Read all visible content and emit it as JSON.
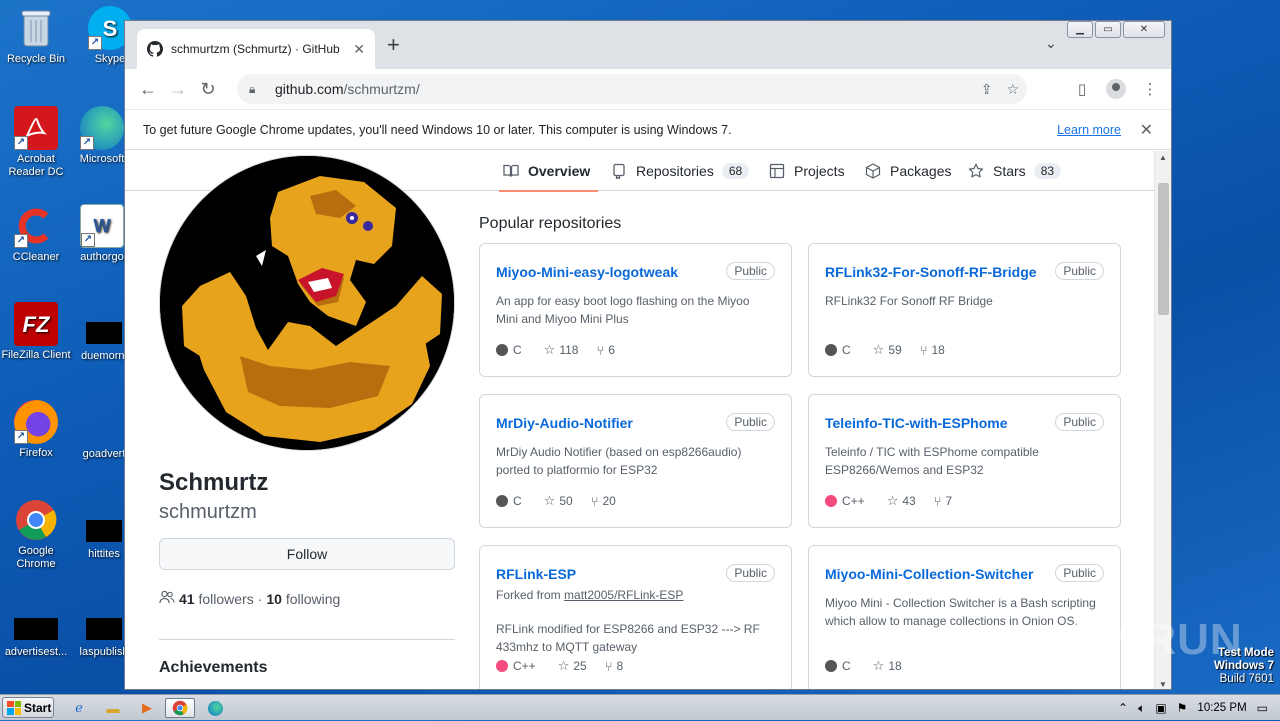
{
  "desktop": {
    "icons": [
      {
        "label": "Recycle Bin"
      },
      {
        "label": "Skype"
      },
      {
        "label": "Acrobat Reader DC"
      },
      {
        "label": "Microsoft"
      },
      {
        "label": "CCleaner"
      },
      {
        "label": "authorgo"
      },
      {
        "label": "FileZilla Client"
      },
      {
        "label": "duemorni"
      },
      {
        "label": "Firefox"
      },
      {
        "label": "goadvert"
      },
      {
        "label": "Google Chrome"
      },
      {
        "label": "hittites"
      },
      {
        "label": "advertisest..."
      },
      {
        "label": "laspublish"
      }
    ]
  },
  "browser": {
    "tab_title": "schmurtzm (Schmurtz) · GitHub",
    "tab_close": "✕",
    "new_tab": "+",
    "url_host": "github.com",
    "url_path": "/schmurtzm/",
    "infobar_text": "To get future Google Chrome updates, you'll need Windows 10 or later. This computer is using Windows 7.",
    "infobar_link": "Learn more",
    "window_buttons": {
      "minimize": "▁",
      "maximize": "▭",
      "close": "✕"
    }
  },
  "profile": {
    "tabs": [
      {
        "label": "Overview",
        "icon": "book-icon",
        "count": ""
      },
      {
        "label": "Repositories",
        "icon": "repo-icon",
        "count": "68"
      },
      {
        "label": "Projects",
        "icon": "table-icon",
        "count": ""
      },
      {
        "label": "Packages",
        "icon": "package-icon",
        "count": ""
      },
      {
        "label": "Stars",
        "icon": "star-icon",
        "count": "83"
      }
    ],
    "name": "Schmurtz",
    "login": "schmurtzm",
    "follow_label": "Follow",
    "followers_count": "41",
    "followers_label": "followers",
    "separator": "·",
    "following_count": "10",
    "following_label": "following",
    "achievements_heading": "Achievements",
    "popular_heading": "Popular repositories"
  },
  "repos": [
    {
      "name": "Miyoo-Mini-easy-logotweak",
      "badge": "Public",
      "desc": "An app for easy boot logo flashing on the Miyoo Mini and Miyoo Mini Plus",
      "lang": "C",
      "lang_color": "#555555",
      "stars": "118",
      "forks": "6"
    },
    {
      "name": "RFLink32-For-Sonoff-RF-Bridge",
      "badge": "Public",
      "desc": "RFLink32 For Sonoff RF Bridge",
      "lang": "C",
      "lang_color": "#555555",
      "stars": "59",
      "forks": "18"
    },
    {
      "name": "MrDiy-Audio-Notifier",
      "badge": "Public",
      "desc": "MrDiy Audio Notifier (based on esp8266audio) ported to platformio for ESP32",
      "lang": "C",
      "lang_color": "#555555",
      "stars": "50",
      "forks": "20"
    },
    {
      "name": "Teleinfo-TIC-with-ESPhome",
      "badge": "Public",
      "desc": "Teleinfo / TIC with ESPhome compatible ESP8266/Wemos and ESP32",
      "lang": "C++",
      "lang_color": "#f34b7d",
      "stars": "43",
      "forks": "7"
    },
    {
      "name": "RFLink-ESP",
      "badge": "Public",
      "forked_prefix": "Forked from",
      "forked_from": "matt2005/RFLink-ESP",
      "desc": "RFLink modified for ESP8266 and ESP32 ---> RF 433mhz to MQTT gateway",
      "lang": "C++",
      "lang_color": "#f34b7d",
      "stars": "25",
      "forks": "8"
    },
    {
      "name": "Miyoo-Mini-Collection-Switcher",
      "badge": "Public",
      "desc": "Miyoo Mini - Collection Switcher is a Bash scripting which allow to manage collections in Onion OS.",
      "lang": "C",
      "lang_color": "#555555",
      "stars": "18",
      "forks": ""
    }
  ],
  "overlay": {
    "watermark": "ANY RUN",
    "testmode_line1": "Test Mode",
    "testmode_line2": "Windows 7",
    "testmode_line3": "Build 7601"
  },
  "taskbar": {
    "start_label": "Start",
    "clock": "10:25 PM"
  }
}
